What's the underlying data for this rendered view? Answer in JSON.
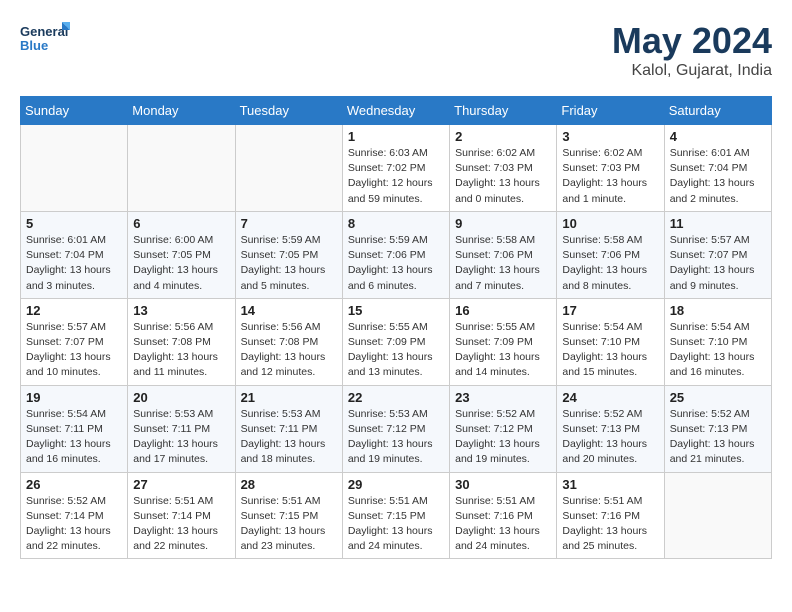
{
  "header": {
    "logo_line1": "General",
    "logo_line2": "Blue",
    "title": "May 2024",
    "subtitle": "Kalol, Gujarat, India"
  },
  "weekdays": [
    "Sunday",
    "Monday",
    "Tuesday",
    "Wednesday",
    "Thursday",
    "Friday",
    "Saturday"
  ],
  "weeks": [
    [
      {
        "day": "",
        "info": ""
      },
      {
        "day": "",
        "info": ""
      },
      {
        "day": "",
        "info": ""
      },
      {
        "day": "1",
        "info": "Sunrise: 6:03 AM\nSunset: 7:02 PM\nDaylight: 12 hours\nand 59 minutes."
      },
      {
        "day": "2",
        "info": "Sunrise: 6:02 AM\nSunset: 7:03 PM\nDaylight: 13 hours\nand 0 minutes."
      },
      {
        "day": "3",
        "info": "Sunrise: 6:02 AM\nSunset: 7:03 PM\nDaylight: 13 hours\nand 1 minute."
      },
      {
        "day": "4",
        "info": "Sunrise: 6:01 AM\nSunset: 7:04 PM\nDaylight: 13 hours\nand 2 minutes."
      }
    ],
    [
      {
        "day": "5",
        "info": "Sunrise: 6:01 AM\nSunset: 7:04 PM\nDaylight: 13 hours\nand 3 minutes."
      },
      {
        "day": "6",
        "info": "Sunrise: 6:00 AM\nSunset: 7:05 PM\nDaylight: 13 hours\nand 4 minutes."
      },
      {
        "day": "7",
        "info": "Sunrise: 5:59 AM\nSunset: 7:05 PM\nDaylight: 13 hours\nand 5 minutes."
      },
      {
        "day": "8",
        "info": "Sunrise: 5:59 AM\nSunset: 7:06 PM\nDaylight: 13 hours\nand 6 minutes."
      },
      {
        "day": "9",
        "info": "Sunrise: 5:58 AM\nSunset: 7:06 PM\nDaylight: 13 hours\nand 7 minutes."
      },
      {
        "day": "10",
        "info": "Sunrise: 5:58 AM\nSunset: 7:06 PM\nDaylight: 13 hours\nand 8 minutes."
      },
      {
        "day": "11",
        "info": "Sunrise: 5:57 AM\nSunset: 7:07 PM\nDaylight: 13 hours\nand 9 minutes."
      }
    ],
    [
      {
        "day": "12",
        "info": "Sunrise: 5:57 AM\nSunset: 7:07 PM\nDaylight: 13 hours\nand 10 minutes."
      },
      {
        "day": "13",
        "info": "Sunrise: 5:56 AM\nSunset: 7:08 PM\nDaylight: 13 hours\nand 11 minutes."
      },
      {
        "day": "14",
        "info": "Sunrise: 5:56 AM\nSunset: 7:08 PM\nDaylight: 13 hours\nand 12 minutes."
      },
      {
        "day": "15",
        "info": "Sunrise: 5:55 AM\nSunset: 7:09 PM\nDaylight: 13 hours\nand 13 minutes."
      },
      {
        "day": "16",
        "info": "Sunrise: 5:55 AM\nSunset: 7:09 PM\nDaylight: 13 hours\nand 14 minutes."
      },
      {
        "day": "17",
        "info": "Sunrise: 5:54 AM\nSunset: 7:10 PM\nDaylight: 13 hours\nand 15 minutes."
      },
      {
        "day": "18",
        "info": "Sunrise: 5:54 AM\nSunset: 7:10 PM\nDaylight: 13 hours\nand 16 minutes."
      }
    ],
    [
      {
        "day": "19",
        "info": "Sunrise: 5:54 AM\nSunset: 7:11 PM\nDaylight: 13 hours\nand 16 minutes."
      },
      {
        "day": "20",
        "info": "Sunrise: 5:53 AM\nSunset: 7:11 PM\nDaylight: 13 hours\nand 17 minutes."
      },
      {
        "day": "21",
        "info": "Sunrise: 5:53 AM\nSunset: 7:11 PM\nDaylight: 13 hours\nand 18 minutes."
      },
      {
        "day": "22",
        "info": "Sunrise: 5:53 AM\nSunset: 7:12 PM\nDaylight: 13 hours\nand 19 minutes."
      },
      {
        "day": "23",
        "info": "Sunrise: 5:52 AM\nSunset: 7:12 PM\nDaylight: 13 hours\nand 19 minutes."
      },
      {
        "day": "24",
        "info": "Sunrise: 5:52 AM\nSunset: 7:13 PM\nDaylight: 13 hours\nand 20 minutes."
      },
      {
        "day": "25",
        "info": "Sunrise: 5:52 AM\nSunset: 7:13 PM\nDaylight: 13 hours\nand 21 minutes."
      }
    ],
    [
      {
        "day": "26",
        "info": "Sunrise: 5:52 AM\nSunset: 7:14 PM\nDaylight: 13 hours\nand 22 minutes."
      },
      {
        "day": "27",
        "info": "Sunrise: 5:51 AM\nSunset: 7:14 PM\nDaylight: 13 hours\nand 22 minutes."
      },
      {
        "day": "28",
        "info": "Sunrise: 5:51 AM\nSunset: 7:15 PM\nDaylight: 13 hours\nand 23 minutes."
      },
      {
        "day": "29",
        "info": "Sunrise: 5:51 AM\nSunset: 7:15 PM\nDaylight: 13 hours\nand 24 minutes."
      },
      {
        "day": "30",
        "info": "Sunrise: 5:51 AM\nSunset: 7:16 PM\nDaylight: 13 hours\nand 24 minutes."
      },
      {
        "day": "31",
        "info": "Sunrise: 5:51 AM\nSunset: 7:16 PM\nDaylight: 13 hours\nand 25 minutes."
      },
      {
        "day": "",
        "info": ""
      }
    ]
  ]
}
